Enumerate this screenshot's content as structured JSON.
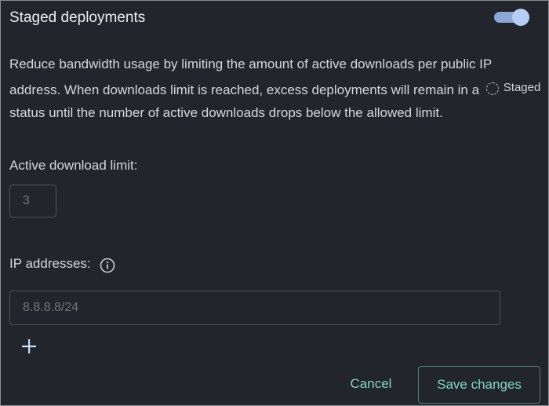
{
  "section": {
    "title": "Staged deployments",
    "enabled": true
  },
  "description": {
    "before": "Reduce bandwidth usage by limiting the amount of active downloads per public IP address. When downloads limit is reached, excess deployments will remain in a ",
    "staged_label": "Staged",
    "after": " status until the number of active downloads drops below the allowed limit."
  },
  "limit": {
    "label": "Active download limit:",
    "placeholder": "3"
  },
  "ip": {
    "label": "IP addresses:",
    "info_icon": "info-icon",
    "placeholder": "8.8.8.8/24",
    "add_icon": "plus-icon"
  },
  "actions": {
    "cancel": "Cancel",
    "save": "Save changes"
  },
  "colors": {
    "background": "#22252b",
    "accent": "#7fd7c7",
    "toggle_on": "#8aa7d6"
  }
}
